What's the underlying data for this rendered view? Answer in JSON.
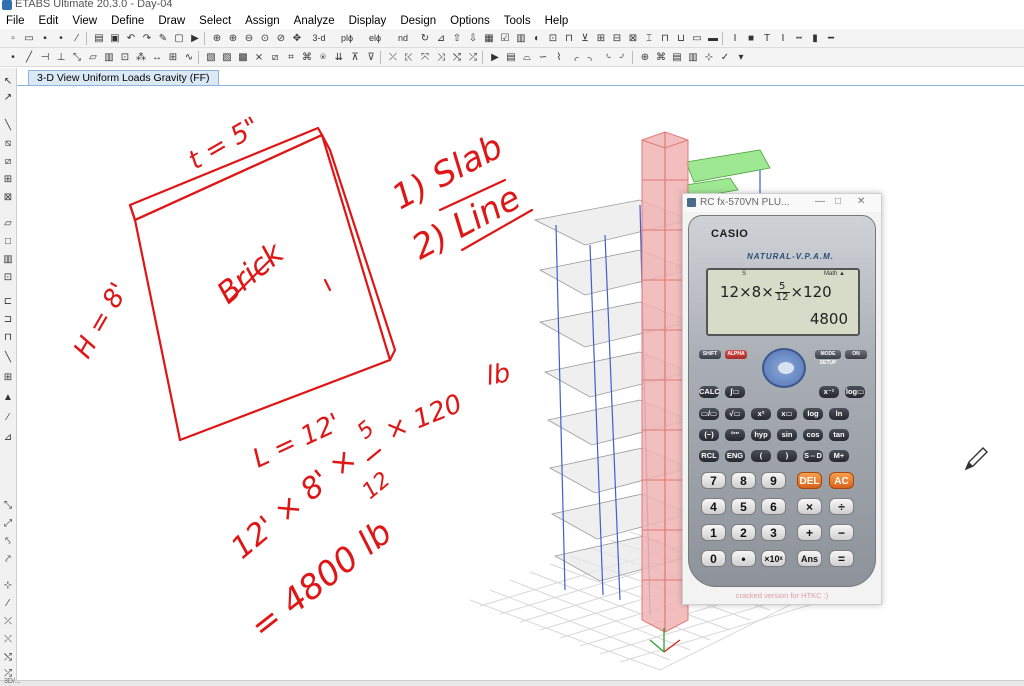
{
  "window": {
    "title": "ETABS Ultimate 20.3.0 - Day-04"
  },
  "menu": [
    "File",
    "Edit",
    "View",
    "Define",
    "Draw",
    "Select",
    "Assign",
    "Analyze",
    "Display",
    "Design",
    "Options",
    "Tools",
    "Help"
  ],
  "toolbar": {
    "view_3d_label": "3-d",
    "plan_label": "plϕ",
    "elev_label": "elϕ",
    "nd_label": "nd"
  },
  "view_tab": {
    "label": "3-D View  Uniform Loads Gravity  (FF)"
  },
  "annotations": {
    "t": "t = 5\"",
    "h": "H = 8'",
    "brick": "Brick",
    "l": "L = 12'",
    "slab": "1) Slab",
    "line": "2) Line",
    "lb": "lb",
    "x120": "× 120",
    "expr_left": "12' × 8' ×",
    "frac_num": "5",
    "frac_den": "12",
    "result": "= 4800 lb"
  },
  "calculator": {
    "window_title": "RC fx-570VN PLU...",
    "brand": "CASIO",
    "model": "NATURAL-V.P.A.M.",
    "indicator_s": "S",
    "indicator_math": "Math ▲",
    "expression_pre": "12×8×",
    "expression_num": "5",
    "expression_den": "12",
    "expression_post": "×120",
    "result": "4800",
    "footer": "cracked version for HTKC :)",
    "keys": {
      "shift": "SHIFT",
      "alpha": "ALPHA",
      "mode": "MODE SETUP",
      "on": "ON",
      "calc": "CALC",
      "integ": "∫▭",
      "xinv": "x⁻¹",
      "logb": "log▭",
      "frac": "▭/▭",
      "sqrt": "√▭",
      "sq": "x²",
      "pow": "x▭",
      "log": "log",
      "ln": "ln",
      "neg": "(−)",
      "dms": "°'\"",
      "hyp": "hyp",
      "sin": "sin",
      "cos": "cos",
      "tan": "tan",
      "rcl": "RCL",
      "eng": "ENG",
      "lparen": "(",
      "rparen": ")",
      "sd": "S⇔D",
      "mplus": "M+",
      "n7": "7",
      "n8": "8",
      "n9": "9",
      "del": "DEL",
      "ac": "AC",
      "n4": "4",
      "n5": "5",
      "n6": "6",
      "mul": "×",
      "div": "÷",
      "n1": "1",
      "n2": "2",
      "n3": "3",
      "plus": "+",
      "minus": "−",
      "n0": "0",
      "dot": "•",
      "exp": "×10ˣ",
      "ans": "Ans",
      "eq": "="
    }
  },
  "status": {
    "text": "3D/..."
  }
}
